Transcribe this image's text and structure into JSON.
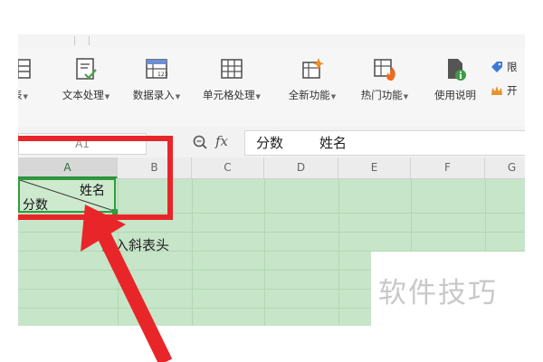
{
  "ribbon": {
    "items": [
      {
        "label": "表",
        "arrow": "▼"
      },
      {
        "label": "文本处理",
        "arrow": "▼"
      },
      {
        "label": "数据录入",
        "arrow": "▼"
      },
      {
        "label": "单元格处理",
        "arrow": "▼"
      },
      {
        "label": "全新功能",
        "arrow": "▼"
      },
      {
        "label": "热门功能",
        "arrow": "▼"
      },
      {
        "label": "使用说明",
        "arrow": ""
      }
    ],
    "side_items": [
      "限",
      "开"
    ]
  },
  "formula_bar": {
    "name_box": "A1",
    "fx_label": "fx",
    "value_part1": "分数",
    "value_part2": "姓名"
  },
  "sheet": {
    "columns": [
      "A",
      "B",
      "C",
      "D",
      "E",
      "F",
      "G"
    ],
    "cell_a1_top_right": "姓名",
    "cell_a1_bottom_left": "分数"
  },
  "annotation": {
    "caption": "插入斜表头",
    "watermark": "软件技巧"
  },
  "colors": {
    "grid_fill": "#c7e5c8",
    "selection_border": "#2f9c3e",
    "annotation_red": "#e8262a"
  }
}
